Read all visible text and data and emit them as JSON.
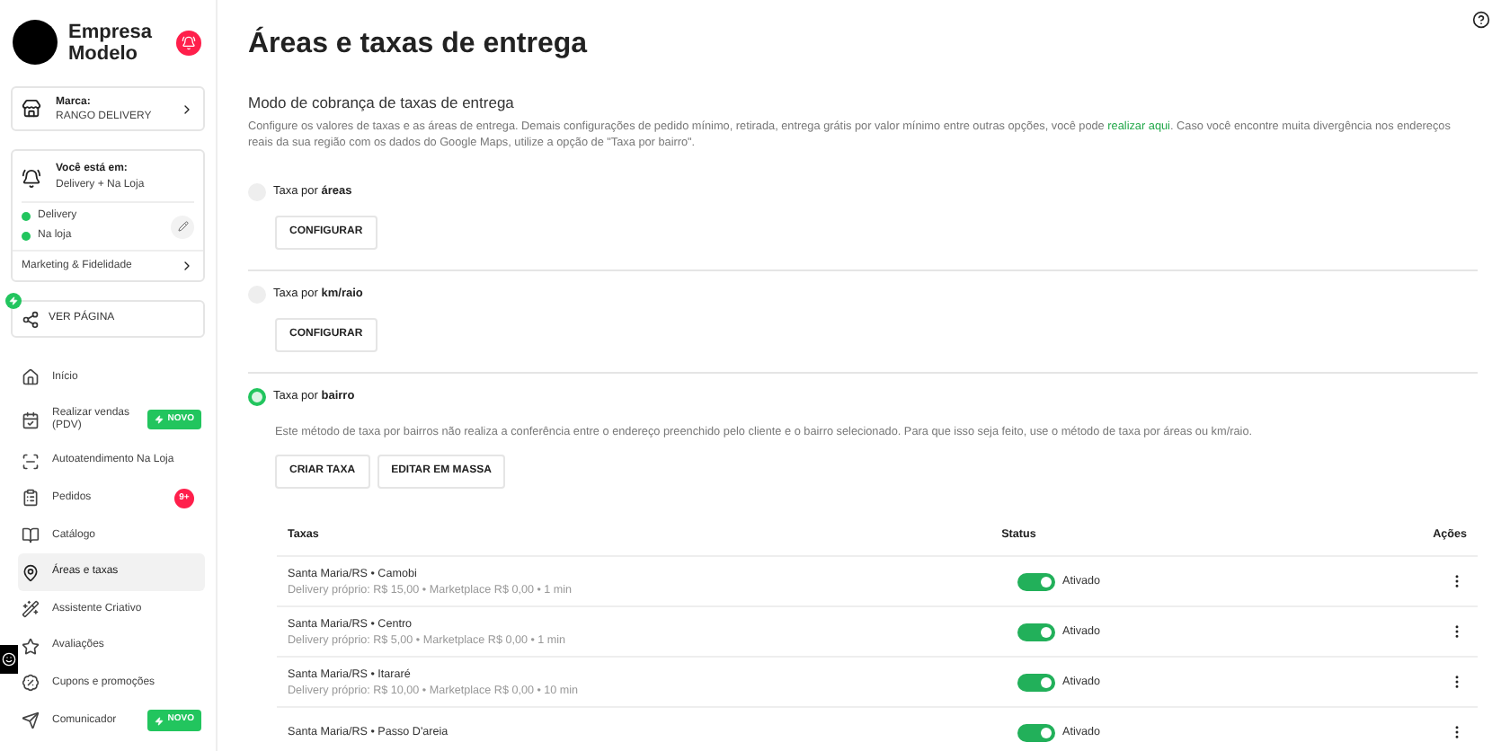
{
  "sidebar": {
    "brand": "Empresa Modelo",
    "brand_card": {
      "label": "Marca:",
      "value": "RANGO DELIVERY"
    },
    "location_card": {
      "label": "Você está em:",
      "value": "Delivery + Na Loja",
      "channels": [
        {
          "name": "Delivery",
          "color": "#22c55e"
        },
        {
          "name": "Na loja",
          "color": "#22c55e"
        }
      ],
      "link": "Marketing & Fidelidade"
    },
    "page_button": "VER PÁGINA",
    "items": [
      {
        "label": "Início",
        "selected": false
      },
      {
        "label": "Realizar vendas (PDV)",
        "selected": false,
        "badge": "NOVO"
      },
      {
        "label": "Autoatendimento Na Loja",
        "selected": false
      },
      {
        "label": "Pedidos",
        "selected": false,
        "count": "9+"
      },
      {
        "label": "Catálogo",
        "selected": false
      },
      {
        "label": "Áreas e taxas",
        "selected": true
      },
      {
        "label": "Assistente Criativo",
        "selected": false
      },
      {
        "label": "Avaliações",
        "selected": false
      },
      {
        "label": "Cupons e promoções",
        "selected": false
      },
      {
        "label": "Comunicador",
        "selected": false,
        "badge": "NOVO"
      }
    ]
  },
  "main": {
    "title": "Áreas e taxas de entrega",
    "section_title": "Modo de cobrança de taxas de entrega",
    "description_before": "Configure os valores de taxas e as áreas de entrega. Demais configurações de pedido mínimo, retirada, entrega grátis por valor mínimo entre outras opções, você pode",
    "description_link": "realizar aqui",
    "description_after": ". Caso você encontre muita divergência nos endereços reais da sua região com os dados do Google Maps, utilize a opção de \"Taxa por bairro\".",
    "modes": [
      {
        "label": "Taxa por **áreas**",
        "selected": false,
        "buttons": [
          "CONFIGURAR"
        ]
      },
      {
        "label": "Taxa por **km/raio**",
        "selected": false,
        "buttons": [
          "CONFIGURAR"
        ]
      },
      {
        "label": "Taxa por **bairro**",
        "selected": true,
        "note": "Este método de taxa por bairros não realiza a conferência entre o endereço preenchido pelo cliente e o bairro selecionado. Para que isso seja feito, use o método de taxa por áreas ou km/raio.",
        "buttons": [
          "CRIAR TAXA",
          "EDITAR EM MASSA"
        ]
      }
    ],
    "table": {
      "columns": [
        "Taxas",
        "Status",
        "Ações"
      ],
      "rows": [
        {
          "name": "Santa Maria/RS • Camobi",
          "details": "Delivery próprio: R$ 15,00 • Marketplace R$ 0,00 • 1 min",
          "on": true,
          "status": "Ativado"
        },
        {
          "name": "Santa Maria/RS • Centro",
          "details": "Delivery próprio: R$ 5,00 • Marketplace R$ 0,00 • 1 min",
          "on": true,
          "status": "Ativado"
        },
        {
          "name": "Santa Maria/RS • Itararé",
          "details": "Delivery próprio: R$ 10,00 • Marketplace R$ 0,00 • 10 min",
          "on": true,
          "status": "Ativado"
        },
        {
          "name": "Santa Maria/RS • Passo D'areia",
          "on": true,
          "status": "Ativado"
        }
      ]
    }
  }
}
